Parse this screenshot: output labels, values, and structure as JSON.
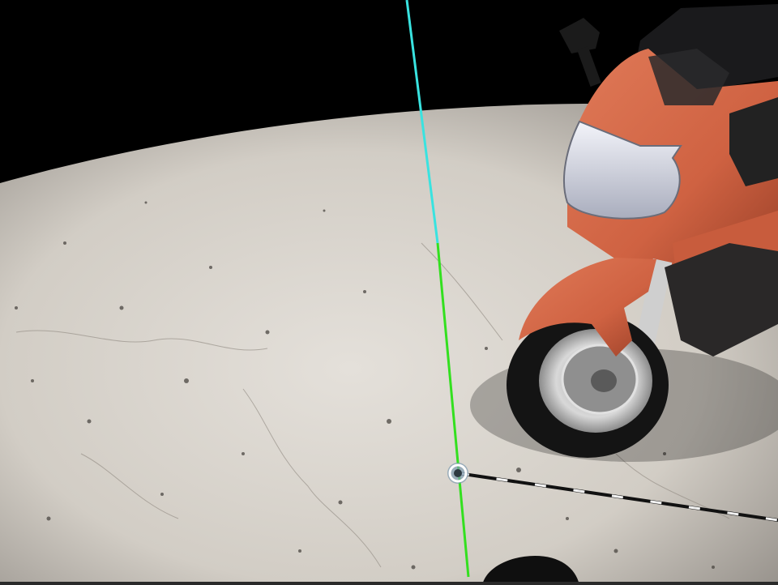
{
  "app": {
    "title": ""
  },
  "scene": {
    "environment": "concrete-floor-arena",
    "object": "motorcycle",
    "colors": {
      "sky": "#000000",
      "floor": "#dcd7d0",
      "floor_shadow": "#9e9890",
      "bike_body": "#d86a4a",
      "bike_body_dark": "#a84a30",
      "headlight": "#d9dbe6",
      "tire": "#151515",
      "rim": "#c9c9c9",
      "vertical_axis_upper": "#39e3e0",
      "vertical_axis_lower": "#33e01f",
      "horizontal_axis": "#111111",
      "cursor_ring": "#ffffff"
    }
  },
  "gizmo": {
    "cursor": "placement-cursor-icon",
    "vertical_axis": "vertical-axis-line",
    "horizontal_axis": "horizontal-axis-line"
  }
}
